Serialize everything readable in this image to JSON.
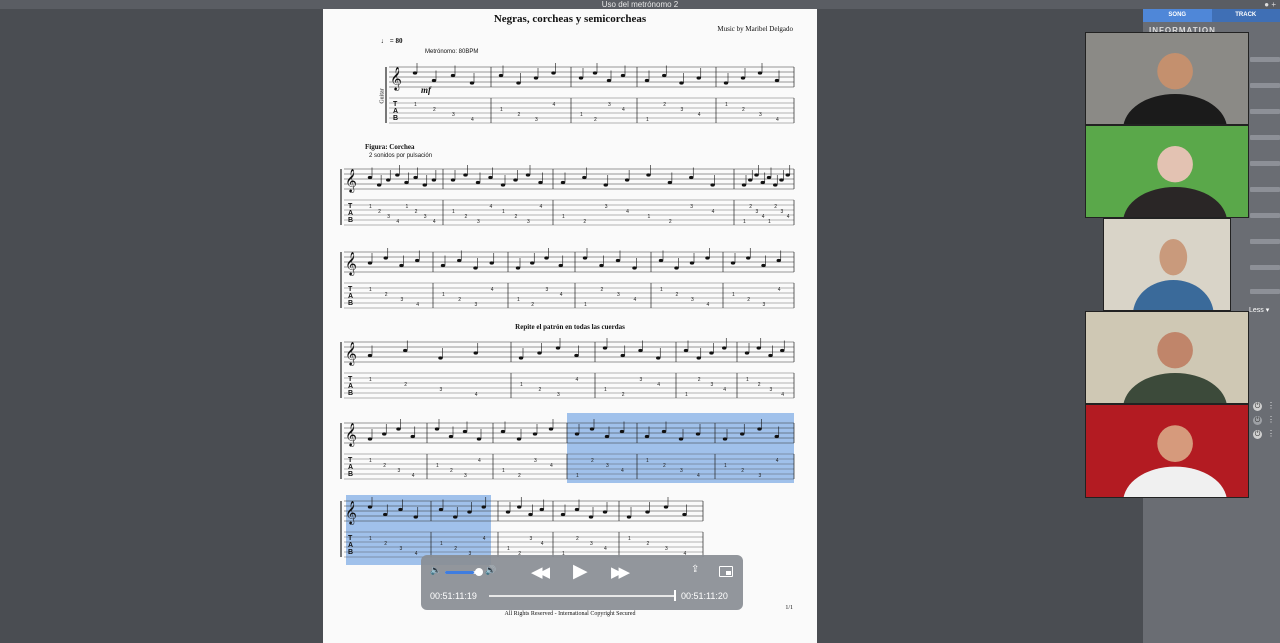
{
  "window": {
    "title": "Uso del metrónomo 2",
    "controls": "● +"
  },
  "sheet": {
    "title": "Negras, corcheas y semicorcheas",
    "composer": "Music by Maribel Delgado",
    "tempo": "♩ = 80",
    "metronome": "Metrónomo: 80BPM",
    "dynamic": "mf",
    "instrument": "Guitar",
    "figure_title": "Figura: Corchea",
    "figure_sub": "2 sonidos por pulsación",
    "repeat_note": "Repite el patrón en todas las cuerdas",
    "copyright": "All Rights Reserved - International Copyright Secured",
    "page": "1/1"
  },
  "side_panel": {
    "tab_song": "SONG",
    "tab_track": "TRACK",
    "info_heading": "INFORMATION",
    "less_label": "Less ▾",
    "power_symbol": "⏻",
    "kebab_symbol": "⋮"
  },
  "player": {
    "elapsed": "00:51:11:19",
    "total": "00:51:11:20",
    "volume_level": 0.85,
    "progress": 0.999,
    "vol_low_icon": "🔈",
    "vol_high_icon": "🔊",
    "rewind_icon": "◀◀",
    "play_icon": "▶",
    "forward_icon": "▶▶",
    "share_icon": "⇪"
  },
  "participants": [
    {
      "name": "participant-1",
      "wall": "#8b8a86",
      "shirt": "#1b1b1b",
      "skin": "#c4906e"
    },
    {
      "name": "participant-2",
      "wall": "#5aa84a",
      "shirt": "#2a2626",
      "skin": "#e3c2b2"
    },
    {
      "name": "participant-3",
      "wall": "#d9d4c8",
      "shirt": "#3a6a9a",
      "skin": "#c99a7c"
    },
    {
      "name": "participant-4",
      "wall": "#cfc8b4",
      "shirt": "#3c4a3a",
      "skin": "#c0856a"
    },
    {
      "name": "participant-5",
      "wall": "#b31b22",
      "shirt": "#f0f0f0",
      "skin": "#d69a7c"
    }
  ],
  "colors": {
    "selection": "#8fb6e8",
    "accent": "#4f87d8"
  }
}
